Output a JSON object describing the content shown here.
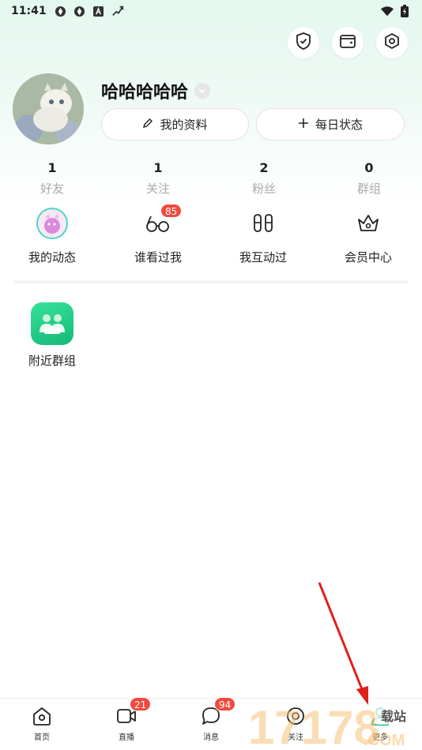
{
  "status_bar": {
    "time": "11:41",
    "left_icons": [
      "sync-icon",
      "sync-icon",
      "a-icon",
      "run-icon"
    ],
    "right_icons": [
      "wifi-icon",
      "battery-icon"
    ]
  },
  "top_actions": [
    "shield-check-icon",
    "wallet-icon",
    "settings-hex-icon"
  ],
  "profile": {
    "name": "哈哈哈哈哈",
    "edit_profile_label": "我的资料",
    "daily_status_label": "每日状态"
  },
  "stats": [
    {
      "count": "1",
      "label": "好友"
    },
    {
      "count": "1",
      "label": "关注"
    },
    {
      "count": "2",
      "label": "粉丝"
    },
    {
      "count": "0",
      "label": "群组"
    }
  ],
  "entries": [
    {
      "label": "我的动态",
      "icon": "moments-avatar-icon"
    },
    {
      "label": "谁看过我",
      "icon": "glasses-icon",
      "badge": "85"
    },
    {
      "label": "我互动过",
      "icon": "footprints-icon"
    },
    {
      "label": "会员中心",
      "icon": "crown-icon"
    }
  ],
  "nearby_group": {
    "label": "附近群组",
    "icon": "group-people-icon"
  },
  "bottom_nav": [
    {
      "label": "首页",
      "icon": "home-icon"
    },
    {
      "label": "直播",
      "icon": "live-video-icon",
      "badge": "21"
    },
    {
      "label": "消息",
      "icon": "chat-bubble-icon",
      "badge": "94"
    },
    {
      "label": "关注",
      "icon": "eye-icon"
    },
    {
      "label": "更多",
      "icon": "person-icon",
      "active": true
    }
  ],
  "watermark": {
    "text": "17178",
    "suffix": ".COM",
    "tag": "载站"
  },
  "colors": {
    "accent_green": "#14b878",
    "badge_red": "#f04a3e",
    "arrow_red": "#e0201a"
  }
}
